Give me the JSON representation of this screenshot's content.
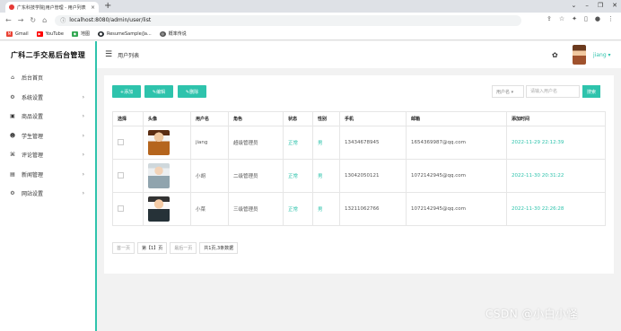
{
  "browser": {
    "tab_title": "广东科技学院|用户管理 - 用户列表",
    "url": "localhost:8080/admin/user/list",
    "bookmarks": [
      {
        "label": "Gmail",
        "color": "#ea4335"
      },
      {
        "label": "YouTube",
        "color": "#ff0000"
      },
      {
        "label": "地图",
        "color": "#34a853"
      },
      {
        "label": "ResumeSample/Ja...",
        "color": "#24292e"
      },
      {
        "label": "概率传说",
        "color": "#555555"
      }
    ]
  },
  "sidebar": {
    "brand": "广科二手交易后台管理",
    "items": [
      {
        "label": "后台首页",
        "icon": "home-icon",
        "glyph": "⌂",
        "has_arrow": false
      },
      {
        "label": "系统设置",
        "icon": "gear-icon",
        "glyph": "⚙",
        "has_arrow": true
      },
      {
        "label": "商品设置",
        "icon": "basket-icon",
        "glyph": "▣",
        "has_arrow": true
      },
      {
        "label": "学生管理",
        "icon": "users-icon",
        "glyph": "☻",
        "has_arrow": true
      },
      {
        "label": "评论管理",
        "icon": "command-icon",
        "glyph": "⌘",
        "has_arrow": true
      },
      {
        "label": "新闻管理",
        "icon": "news-icon",
        "glyph": "▤",
        "has_arrow": true
      },
      {
        "label": "网站设置",
        "icon": "cog-icon",
        "glyph": "⚙",
        "has_arrow": true
      }
    ]
  },
  "header": {
    "breadcrumb": "用户列表",
    "username": "jiang"
  },
  "toolbar": {
    "add_label": "+添加",
    "edit_label": "✎编辑",
    "delete_label": "✎删除",
    "search_type": "用户名 ▾",
    "search_placeholder": "请输入用户名",
    "search_button": "搜索"
  },
  "table": {
    "headers": [
      "选择",
      "头像",
      "用户名",
      "角色",
      "状态",
      "性别",
      "手机",
      "邮箱",
      "添加时间"
    ],
    "rows": [
      {
        "username": "jiang",
        "role": "超级管理员",
        "status": "正常",
        "gender": "男",
        "phone": "13434678945",
        "email": "1654369987@qq.com",
        "time": "2022-11-29 22:12:39",
        "avatar": "ava1"
      },
      {
        "username": "小胡",
        "role": "二级管理员",
        "status": "正常",
        "gender": "男",
        "phone": "13042050121",
        "email": "1072142945@qq.com",
        "time": "2022-11-30 20:31:22",
        "avatar": "ava2"
      },
      {
        "username": "小菜",
        "role": "三级管理员",
        "status": "正常",
        "gender": "男",
        "phone": "13211062766",
        "email": "1072142945@qq.com",
        "time": "2022-11-30 22:26:28",
        "avatar": "ava3"
      }
    ]
  },
  "pagination": {
    "first": "首一页",
    "current": "第【1】页",
    "last": "最后一页",
    "summary": "共1页,3条数据"
  },
  "watermark": "CSDN @小白小怪",
  "colors": {
    "accent": "#2ec3ac"
  }
}
